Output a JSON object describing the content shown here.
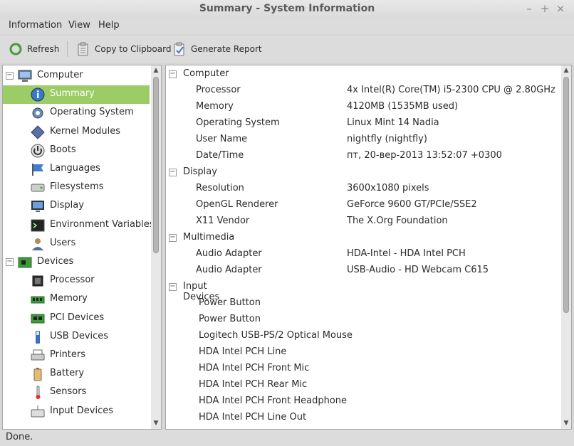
{
  "window": {
    "title": "Summary - System Information"
  },
  "menu": [
    "Information",
    "View",
    "Help"
  ],
  "toolbar": {
    "refresh": "Refresh",
    "copy": "Copy to Clipboard",
    "report": "Generate Report"
  },
  "tree": [
    {
      "label": "Computer",
      "icon": "computer-icon",
      "level": 0,
      "expanded": true
    },
    {
      "label": "Summary",
      "icon": "info-icon",
      "level": 1,
      "selected": true
    },
    {
      "label": "Operating System",
      "icon": "gear-icon",
      "level": 1
    },
    {
      "label": "Kernel Modules",
      "icon": "module-icon",
      "level": 1
    },
    {
      "label": "Boots",
      "icon": "power-icon",
      "level": 1
    },
    {
      "label": "Languages",
      "icon": "flag-icon",
      "level": 1
    },
    {
      "label": "Filesystems",
      "icon": "drive-icon",
      "level": 1
    },
    {
      "label": "Display",
      "icon": "monitor-icon",
      "level": 1
    },
    {
      "label": "Environment Variables",
      "icon": "terminal-icon",
      "level": 1
    },
    {
      "label": "Users",
      "icon": "user-icon",
      "level": 1
    },
    {
      "label": "Devices",
      "icon": "board-icon",
      "level": 0,
      "expanded": true
    },
    {
      "label": "Processor",
      "icon": "cpu-icon",
      "level": 1
    },
    {
      "label": "Memory",
      "icon": "ram-icon",
      "level": 1
    },
    {
      "label": "PCI Devices",
      "icon": "pci-icon",
      "level": 1
    },
    {
      "label": "USB Devices",
      "icon": "usb-icon",
      "level": 1
    },
    {
      "label": "Printers",
      "icon": "printer-icon",
      "level": 1
    },
    {
      "label": "Battery",
      "icon": "battery-icon",
      "level": 1
    },
    {
      "label": "Sensors",
      "icon": "thermometer-icon",
      "level": 1
    },
    {
      "label": "Input Devices",
      "icon": "keyboard-icon",
      "level": 1
    }
  ],
  "details": [
    {
      "section": "Computer",
      "rows": [
        [
          "Processor",
          "4x Intel(R) Core(TM) i5-2300 CPU @ 2.80GHz"
        ],
        [
          "Memory",
          "4120MB (1535MB used)"
        ],
        [
          "Operating System",
          "Linux Mint 14 Nadia"
        ],
        [
          "User Name",
          "nightfly (nightfly)"
        ],
        [
          "Date/Time",
          "пт, 20-вер-2013 13:52:07 +0300"
        ]
      ]
    },
    {
      "section": "Display",
      "rows": [
        [
          "Resolution",
          "3600x1080 pixels"
        ],
        [
          "OpenGL Renderer",
          "GeForce 9600 GT/PCIe/SSE2"
        ],
        [
          "X11 Vendor",
          "The X.Org Foundation"
        ]
      ]
    },
    {
      "section": "Multimedia",
      "rows": [
        [
          "Audio Adapter",
          "HDA-Intel - HDA Intel PCH"
        ],
        [
          "Audio Adapter",
          "USB-Audio - HD Webcam C615"
        ]
      ]
    },
    {
      "section": "Input Devices",
      "rows": [
        [
          "Power Button",
          ""
        ],
        [
          "Power Button",
          ""
        ],
        [
          "Logitech USB-PS/2 Optical Mouse",
          ""
        ],
        [
          "HDA Intel PCH Line",
          ""
        ],
        [
          "HDA Intel PCH Front Mic",
          ""
        ],
        [
          "HDA Intel PCH Rear Mic",
          ""
        ],
        [
          "HDA Intel PCH Front Headphone",
          ""
        ],
        [
          "HDA Intel PCH Line Out",
          ""
        ]
      ]
    }
  ],
  "status": "Done."
}
